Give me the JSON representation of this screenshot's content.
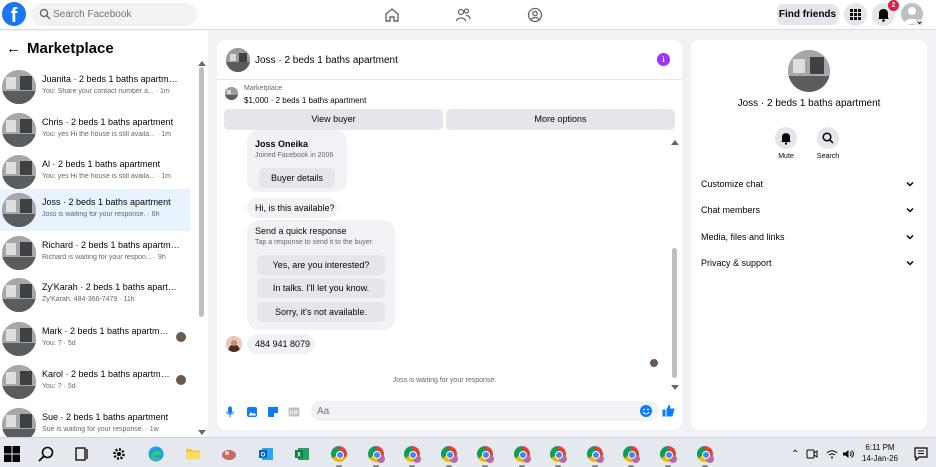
{
  "topbar": {
    "logo_letter": "f",
    "search_placeholder": "Search Facebook",
    "find_friends": "Find friends",
    "notification_count": "2"
  },
  "marketplace": {
    "title": "Marketplace",
    "conversations": [
      {
        "name": "Juanita · 2 beds 1 baths apartm…",
        "preview": "You: Share your contact number a... · 1m",
        "active": false
      },
      {
        "name": "Chris · 2 beds 1 baths apartment",
        "preview": "You: yes Hi the house is still availa... · 1m",
        "active": false
      },
      {
        "name": "Al · 2 beds 1 baths apartment",
        "preview": "You: yes Hi the house is still availa... · 1m",
        "active": false
      },
      {
        "name": "Joss · 2 beds 1 baths apartment",
        "preview": "Joss is waiting for your response. · 6h",
        "active": true
      },
      {
        "name": "Richard · 2 beds 1 baths apartm…",
        "preview": "Richard is waiting for your respon... · 9h",
        "active": false
      },
      {
        "name": "Zy'Karah · 2 beds 1 baths apart…",
        "preview": "Zy'Karah: 484-366-7479 · 11h",
        "active": false
      },
      {
        "name": "Mark · 2 beds 1 baths apartm…",
        "preview": "You: ? · 5d",
        "active": false
      },
      {
        "name": "Karol · 2 beds 1 baths apartm…",
        "preview": "You: ? · 5d",
        "active": false
      },
      {
        "name": "Sue · 2 beds 1 baths apartment",
        "preview": "Sue is waiting for your response. · 1w",
        "active": false
      }
    ]
  },
  "chat": {
    "title": "Joss · 2 beds 1 baths apartment",
    "info_glyph": "i",
    "listing_source": "Marketplace",
    "listing_price": "$1,000 · 2 beds 1 baths apartment",
    "view_buyer": "View buyer",
    "more_options": "More options",
    "buyer_name": "Joss Oneika",
    "buyer_joined": "Joined Facebook in 2006",
    "buyer_details": "Buyer details",
    "first_message": "Hi, is this available?",
    "quick_title": "Send a quick response",
    "quick_sub": "Tap a response to send it to the buyer.",
    "quick_responses": [
      "Yes, are you interested?",
      "In talks. I'll let you know.",
      "Sorry, it's not available."
    ],
    "phone_message": "484 941 8079",
    "status": "Joss is waiting for your response.",
    "composer_placeholder": "Aa"
  },
  "details": {
    "name": "Joss · 2 beds 1 baths apartment",
    "mute": "Mute",
    "search": "Search",
    "sections": [
      "Customize chat",
      "Chat members",
      "Media, files and links",
      "Privacy & support"
    ]
  },
  "taskbar": {
    "time": "6:11 PM",
    "date": "14-Jan-26"
  }
}
